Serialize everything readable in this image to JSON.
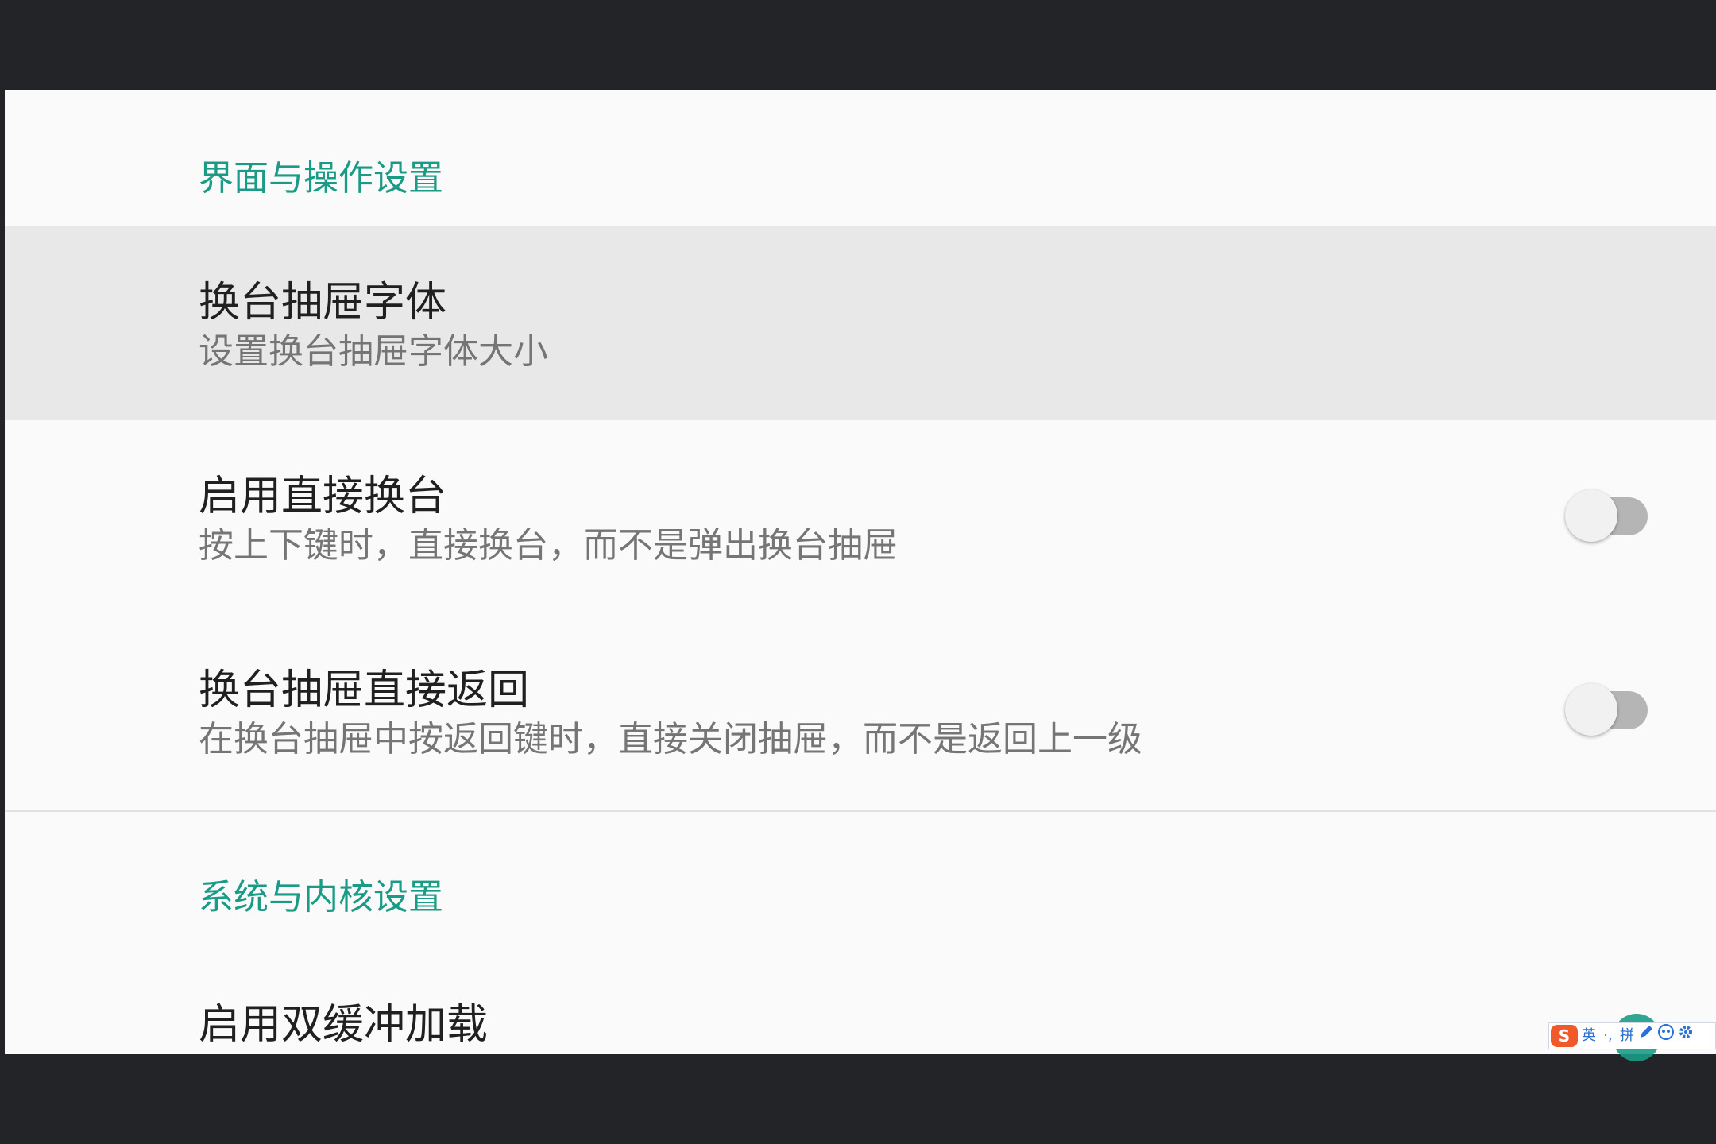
{
  "colors": {
    "accent": "#1a9b86",
    "background": "#fafafa",
    "highlight": "#e8e8e8",
    "frame": "#232427"
  },
  "sections": [
    {
      "header": "界面与操作设置",
      "items": [
        {
          "title": "换台抽屉字体",
          "subtitle": "设置换台抽屉字体大小",
          "highlighted": true
        },
        {
          "title": "启用直接换台",
          "subtitle": "按上下键时，直接换台，而不是弹出换台抽屉",
          "toggle": false
        },
        {
          "title": "换台抽屉直接返回",
          "subtitle": "在换台抽屉中按返回键时，直接关闭抽屉，而不是返回上一级",
          "toggle": false
        }
      ]
    },
    {
      "header": "系统与内核设置",
      "items": [
        {
          "title": "启用双缓冲加载"
        }
      ]
    }
  ],
  "ime_toolbar": {
    "logo": "S",
    "items": [
      "英",
      "·,",
      "拼",
      "pen-icon",
      "face-icon",
      "gear-icon"
    ]
  }
}
